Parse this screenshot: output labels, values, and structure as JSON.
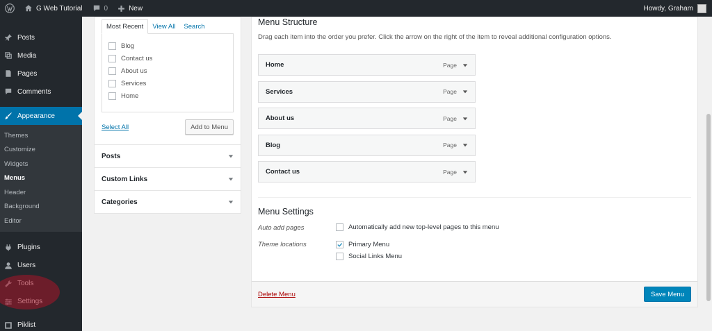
{
  "adminbar": {
    "site_name": "G Web Tutorial",
    "comments_count": "0",
    "new_label": "New",
    "howdy": "Howdy, Graham"
  },
  "sidebar": {
    "items_top": [
      {
        "label": "Posts",
        "icon": "pin-icon"
      },
      {
        "label": "Media",
        "icon": "media-icon"
      },
      {
        "label": "Pages",
        "icon": "pages-icon"
      },
      {
        "label": "Comments",
        "icon": "comments-icon"
      }
    ],
    "current": {
      "label": "Appearance",
      "icon": "paintbrush-icon"
    },
    "submenu": [
      "Themes",
      "Customize",
      "Widgets",
      "Menus",
      "Header",
      "Background",
      "Editor"
    ],
    "submenu_active": "Menus",
    "items_bottom": [
      {
        "label": "Plugins",
        "icon": "plugin-icon"
      },
      {
        "label": "Users",
        "icon": "users-icon"
      },
      {
        "label": "Tools",
        "icon": "tools-icon"
      },
      {
        "label": "Settings",
        "icon": "settings-icon"
      },
      {
        "label": "Piklist",
        "icon": "piklist-icon"
      }
    ]
  },
  "pages_panel": {
    "tabs": [
      "Most Recent",
      "View All",
      "Search"
    ],
    "active_tab": "Most Recent",
    "items": [
      "Blog",
      "Contact us",
      "About us",
      "Services",
      "Home"
    ],
    "select_all": "Select All",
    "add_button": "Add to Menu"
  },
  "accordions": [
    "Posts",
    "Custom Links",
    "Categories"
  ],
  "menu_structure": {
    "title": "Menu Structure",
    "instructions": "Drag each item into the order you prefer. Click the arrow on the right of the item to reveal additional configuration options.",
    "items": [
      {
        "title": "Home",
        "type": "Page"
      },
      {
        "title": "Services",
        "type": "Page"
      },
      {
        "title": "About us",
        "type": "Page"
      },
      {
        "title": "Blog",
        "type": "Page"
      },
      {
        "title": "Contact us",
        "type": "Page"
      }
    ]
  },
  "menu_settings": {
    "title": "Menu Settings",
    "auto_add_label": "Auto add pages",
    "auto_add_option": "Automatically add new top-level pages to this menu",
    "theme_locations_label": "Theme locations",
    "locations": [
      {
        "label": "Primary Menu",
        "checked": true
      },
      {
        "label": "Social Links Menu",
        "checked": false
      }
    ]
  },
  "footer": {
    "delete_label": "Delete Menu",
    "save_label": "Save Menu"
  },
  "colors": {
    "accent": "#0073aa",
    "primary_button": "#0085ba",
    "admin_dark": "#23282d",
    "delete_red": "#aa0000",
    "highlight": "#aa1428"
  }
}
